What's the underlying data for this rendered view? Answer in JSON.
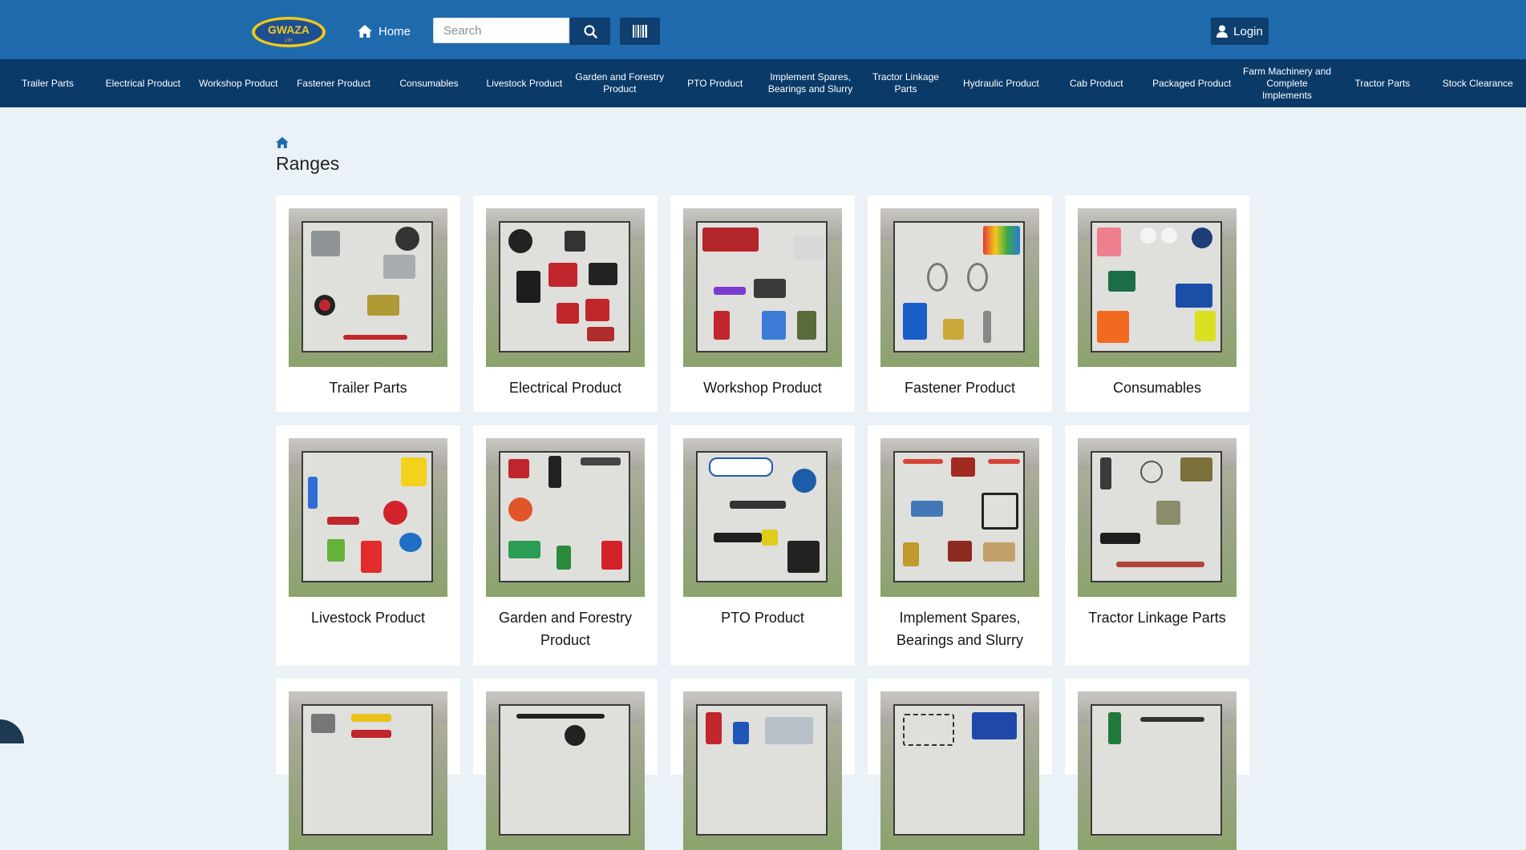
{
  "header": {
    "logo_text": "GWAZA",
    "logo_sub": "LTD",
    "home_label": "Home",
    "search_placeholder": "Search",
    "login_label": "Login"
  },
  "nav": {
    "items": [
      "Trailer Parts",
      "Electrical Product",
      "Workshop Product",
      "Fastener Product",
      "Consumables",
      "Livestock Product",
      "Garden and Forestry Product",
      "PTO Product",
      "Implement Spares, Bearings and Slurry",
      "Tractor Linkage Parts",
      "Hydraulic Product",
      "Cab Product",
      "Packaged Product",
      "Farm Machinery and Complete Implements",
      "Tractor Parts",
      "Stock Clearance"
    ]
  },
  "page": {
    "title": "Ranges"
  },
  "ranges": [
    {
      "label": "Trailer Parts"
    },
    {
      "label": "Electrical Product"
    },
    {
      "label": "Workshop Product"
    },
    {
      "label": "Fastener Product"
    },
    {
      "label": "Consumables"
    },
    {
      "label": "Livestock Product"
    },
    {
      "label": "Garden and Forestry Product"
    },
    {
      "label": "PTO Product"
    },
    {
      "label": "Implement Spares, Bearings and Slurry"
    },
    {
      "label": "Tractor Linkage Parts"
    },
    {
      "label": ""
    },
    {
      "label": ""
    },
    {
      "label": ""
    },
    {
      "label": ""
    },
    {
      "label": ""
    }
  ],
  "colors": {
    "header_bg": "#1e6aad",
    "nav_bg": "#0a3a68",
    "button_bg": "#0e3f6e",
    "page_bg": "#eaf2f7",
    "logo_yellow": "#f2c91a"
  }
}
